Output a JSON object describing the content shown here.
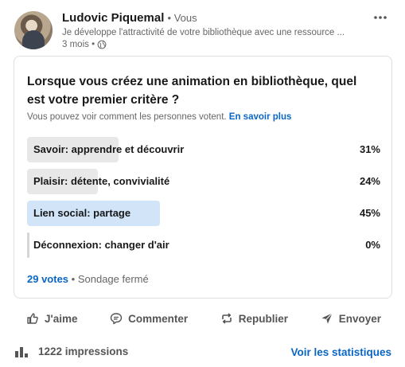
{
  "author": {
    "name": "Ludovic Piquemal",
    "badge": "• Vous",
    "headline": "Je développe l'attractivité de votre bibliothèque avec une ressource ...",
    "time": "3 mois •"
  },
  "poll": {
    "question": "Lorsque vous créez une animation en bibliothèque, quel est votre premier critère ?",
    "visibility_note": "Vous pouvez voir comment les personnes votent.",
    "learn_more": "En savoir plus",
    "options": [
      {
        "label": "Savoir: apprendre et découvrir",
        "percent_label": "31%",
        "percent": 31,
        "selected": false
      },
      {
        "label": "Plaisir: détente, convivialité",
        "percent_label": "24%",
        "percent": 24,
        "selected": false
      },
      {
        "label": "Lien social: partage",
        "percent_label": "45%",
        "percent": 45,
        "selected": true
      },
      {
        "label": "Déconnexion: changer d'air",
        "percent_label": "0%",
        "percent": 0,
        "selected": false
      }
    ],
    "votes": "29 votes",
    "status": "• Sondage fermé"
  },
  "actions": {
    "like": "J'aime",
    "comment": "Commenter",
    "repost": "Republier",
    "send": "Envoyer"
  },
  "stats": {
    "impressions": "1222 impressions",
    "view_stats": "Voir les statistiques"
  },
  "icons": [
    "more-icon",
    "globe-icon",
    "like-icon",
    "comment-icon",
    "repost-icon",
    "send-icon",
    "bar-chart-icon"
  ],
  "colors": {
    "link": "#0a66c2",
    "selected_bar": "#d2e5f8",
    "bar": "#e8e8e8"
  }
}
